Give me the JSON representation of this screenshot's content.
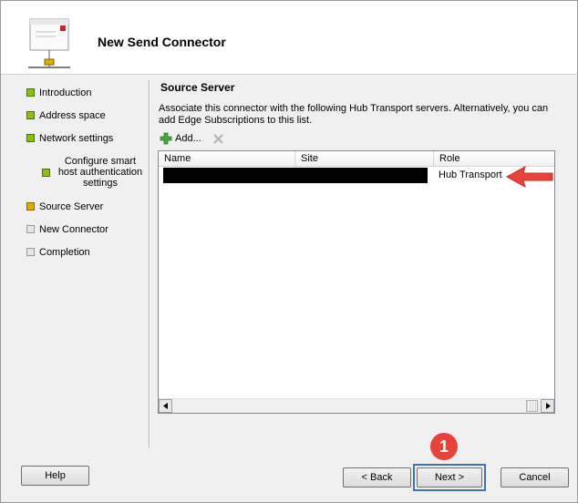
{
  "window": {
    "title": "New Send Connector"
  },
  "nav": {
    "items": [
      {
        "label": "Introduction",
        "state": "green"
      },
      {
        "label": "Address space",
        "state": "green"
      },
      {
        "label": "Network settings",
        "state": "green"
      },
      {
        "label": "Configure smart host authentication settings",
        "state": "green"
      },
      {
        "label": "Source Server",
        "state": "yellow"
      },
      {
        "label": "New Connector",
        "state": "gray"
      },
      {
        "label": "Completion",
        "state": "gray"
      }
    ]
  },
  "main": {
    "section_title": "Source Server",
    "description": "Associate this connector with the following Hub Transport servers. Alternatively, you can add Edge Subscriptions to this list.",
    "toolbar": {
      "add_label": "Add...",
      "add_icon": "plus-icon",
      "remove_icon": "x-icon"
    },
    "grid": {
      "columns": [
        "Name",
        "Site",
        "Role"
      ],
      "rows": [
        {
          "name": "",
          "site": "",
          "role": "Hub Transport",
          "redacted": true
        }
      ]
    }
  },
  "annotations": {
    "step_badge": "1",
    "arrow_color": "#e8433a",
    "highlight_color": "#3e72b6"
  },
  "footer": {
    "help": "Help",
    "back": "< Back",
    "next": "Next >",
    "cancel": "Cancel"
  }
}
